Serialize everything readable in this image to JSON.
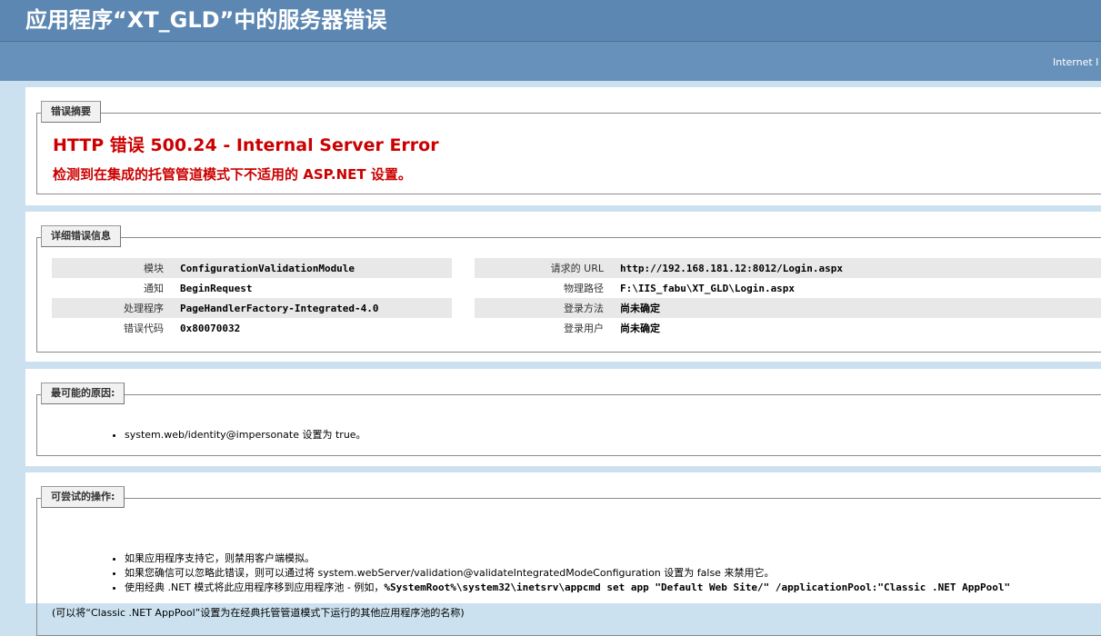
{
  "header": {
    "title": "应用程序“XT_GLD”中的服务器错误",
    "server_label": "Internet I"
  },
  "summary": {
    "legend": "错误摘要",
    "error_title": "HTTP 错误 500.24 - Internal Server Error",
    "error_subtitle": "检测到在集成的托管管道模式下不适用的 ASP.NET 设置。"
  },
  "details": {
    "legend": "详细错误信息",
    "left": [
      {
        "label": "模块",
        "value": "ConfigurationValidationModule"
      },
      {
        "label": "通知",
        "value": "BeginRequest"
      },
      {
        "label": "处理程序",
        "value": "PageHandlerFactory-Integrated-4.0"
      },
      {
        "label": "错误代码",
        "value": "0x80070032"
      }
    ],
    "right": [
      {
        "label": "请求的 URL",
        "value": "http://192.168.181.12:8012/Login.aspx"
      },
      {
        "label": "物理路径",
        "value": "F:\\IIS_fabu\\XT_GLD\\Login.aspx"
      },
      {
        "label": "登录方法",
        "value": "尚未确定"
      },
      {
        "label": "登录用户",
        "value": "尚未确定"
      }
    ]
  },
  "causes": {
    "legend": "最可能的原因:",
    "items": [
      "system.web/identity@impersonate 设置为 true。"
    ]
  },
  "actions": {
    "legend": "可尝试的操作:",
    "item1": "如果应用程序支持它，则禁用客户端模拟。",
    "item2": "如果您确信可以忽略此错误，则可以通过将 system.webServer/validation@validateIntegratedModeConfiguration 设置为 false 来禁用它。",
    "item3_prefix": "使用经典 .NET 模式将此应用程序移到应用程序池 - 例如，",
    "item3_command": "%SystemRoot%\\system32\\inetsrv\\appcmd set app \"Default Web Site/\" /applicationPool:\"Classic .NET AppPool\"",
    "note": "(可以将“Classic .NET AppPool”设置为在经典托管管道模式下运行的其他应用程序池的名称)"
  }
}
